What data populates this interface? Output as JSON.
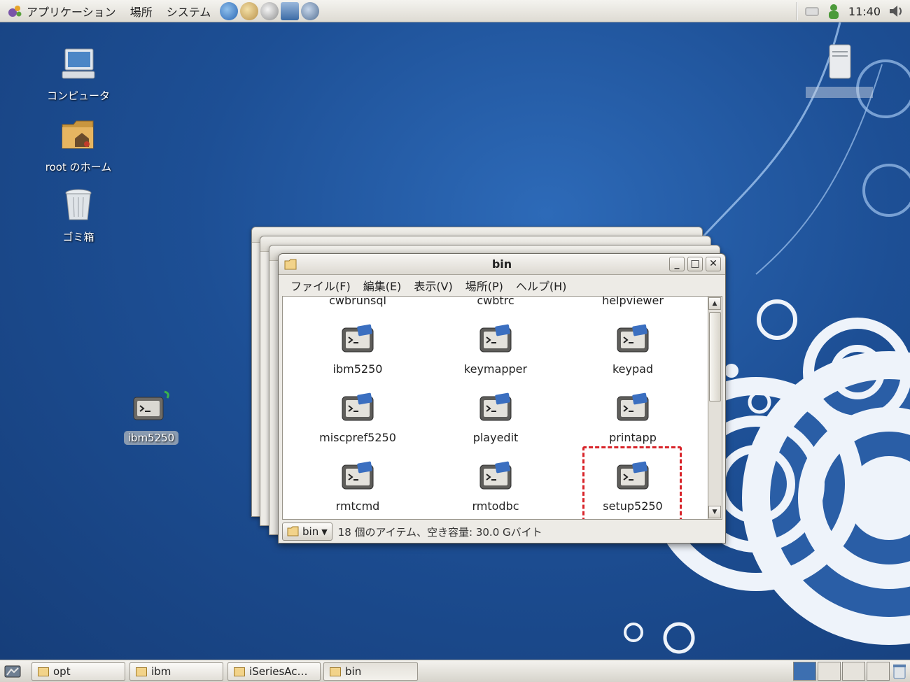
{
  "top_panel": {
    "menus": [
      "アプリケーション",
      "場所",
      "システム"
    ],
    "clock": "11:40"
  },
  "desktop_icons": [
    {
      "label": "コンピュータ",
      "icon": "computer-icon"
    },
    {
      "label": "root のホーム",
      "icon": "home-folder-icon"
    },
    {
      "label": "ゴミ箱",
      "icon": "trash-icon"
    },
    {
      "label": "ibm5250",
      "icon": "terminal-launcher-icon"
    }
  ],
  "window": {
    "title": "bin",
    "menus": [
      "ファイル(F)",
      "編集(E)",
      "表示(V)",
      "場所(P)",
      "ヘルプ(H)"
    ],
    "partial_row": [
      "cwbrunsql",
      "cwbtrc",
      "helpviewer"
    ],
    "files": [
      {
        "name": "ibm5250"
      },
      {
        "name": "keymapper"
      },
      {
        "name": "keypad"
      },
      {
        "name": "miscpref5250"
      },
      {
        "name": "playedit"
      },
      {
        "name": "printapp"
      },
      {
        "name": "rmtcmd"
      },
      {
        "name": "rmtodbc"
      },
      {
        "name": "setup5250"
      }
    ],
    "location": "bin",
    "status": "18 個のアイテム、空き容量: 30.0 Gバイト"
  },
  "taskbar": {
    "buttons": [
      "opt",
      "ibm",
      "iSeriesAc…",
      "bin"
    ]
  },
  "colors": {
    "highlight": "#d8242a",
    "desktop": "#1d4f95"
  }
}
